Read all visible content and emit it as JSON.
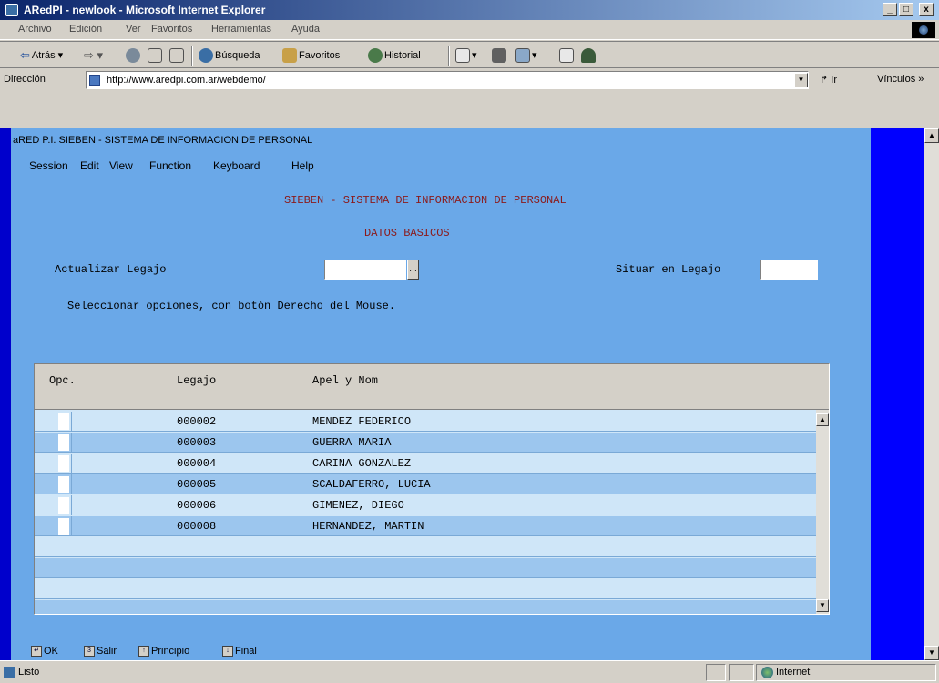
{
  "window": {
    "title": "ARedPI - newlook - Microsoft Internet Explorer",
    "controls": [
      "_",
      "□",
      "x"
    ]
  },
  "menu": [
    "Archivo",
    "Edición",
    "Ver",
    "Favoritos",
    "Herramientas",
    "Ayuda"
  ],
  "toolbar": {
    "back": "Atrás",
    "search": "Búsqueda",
    "favorites": "Favoritos",
    "history": "Historial"
  },
  "address": {
    "label": "Dirección",
    "url": "http://www.aredpi.com.ar/webdemo/",
    "go": "Ir",
    "links": "Vínculos"
  },
  "app": {
    "title": "aRED P.I. SIEBEN - SISTEMA DE INFORMACION DE PERSONAL",
    "menu": [
      "Session",
      "Edit",
      "View",
      "Function",
      "Keyboard",
      "Help"
    ],
    "heading": "SIEBEN - SISTEMA DE INFORMACION DE PERSONAL",
    "subheading": "DATOS BASICOS",
    "actualizar_label": "Actualizar Legajo",
    "actualizar_value": "",
    "situar_label": "Situar en Legajo",
    "situar_value": "",
    "hint": "Seleccionar opciones, con botón Derecho del Mouse."
  },
  "grid": {
    "columns": [
      "Opc.",
      "Legajo",
      "Apel y Nom"
    ],
    "rows": [
      {
        "legajo": "000002",
        "nombre": "MENDEZ FEDERICO"
      },
      {
        "legajo": "000003",
        "nombre": "GUERRA MARIA"
      },
      {
        "legajo": "000004",
        "nombre": "CARINA GONZALEZ"
      },
      {
        "legajo": "000005",
        "nombre": "SCALDAFERRO, LUCIA"
      },
      {
        "legajo": "000006",
        "nombre": "GIMENEZ, DIEGO"
      },
      {
        "legajo": "000008",
        "nombre": "HERNANDEZ, MARTIN"
      }
    ]
  },
  "function_keys": [
    {
      "key": "↵",
      "label": "OK"
    },
    {
      "key": "3",
      "label": "Salir"
    },
    {
      "key": "↑",
      "label": "Principio"
    },
    {
      "key": "↓",
      "label": "Final"
    }
  ],
  "status": {
    "message": "Listo",
    "zone": "Internet"
  },
  "colors": {
    "content_bg": "#6aa8e8",
    "row_light": "#cfe6f8",
    "row_dark": "#9cc6ee",
    "heading_text": "#8b1a1a",
    "frame_blue": "#0000ff"
  }
}
